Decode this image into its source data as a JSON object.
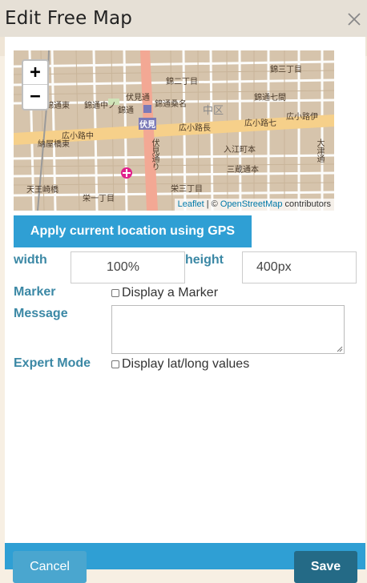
{
  "dialog": {
    "title": "Edit Free Map",
    "close_icon": "close-icon"
  },
  "map": {
    "zoom_in_label": "+",
    "zoom_out_label": "−",
    "attribution": {
      "leaflet": "Leaflet",
      "separator": " | © ",
      "osm": "OpenStreetMap",
      "suffix": " contributors"
    },
    "place_labels": [
      "伏見通",
      "錦二丁目",
      "錦三丁目",
      "錦通東",
      "錦通中ノ",
      "錦通",
      "錦通桑名",
      "錦通七間",
      "中区",
      "伏見",
      "広小路中",
      "広小路長",
      "広小路七",
      "広小路伊",
      "納屋橋東",
      "入江町本",
      "三蔵通本",
      "天王崎橋",
      "栄一丁目",
      "栄三丁目",
      "大津通",
      "伏見通り"
    ]
  },
  "gps_button": {
    "label": "Apply current location using GPS"
  },
  "fields": {
    "width_label": "width",
    "width_value": "100%",
    "height_label": "height",
    "height_value": "400px",
    "marker_label": "Marker",
    "marker_checkbox_label": "Display a Marker",
    "message_label": "Message",
    "message_value": "",
    "expert_label": "Expert Mode",
    "expert_checkbox_label": "Display lat/long values"
  },
  "footer": {
    "cancel_label": "Cancel",
    "save_label": "Save"
  },
  "colors": {
    "accent": "#2f9fd4",
    "label_text": "#3b88a5",
    "save_button": "#246a86",
    "header_bg": "#e6e0d6"
  }
}
